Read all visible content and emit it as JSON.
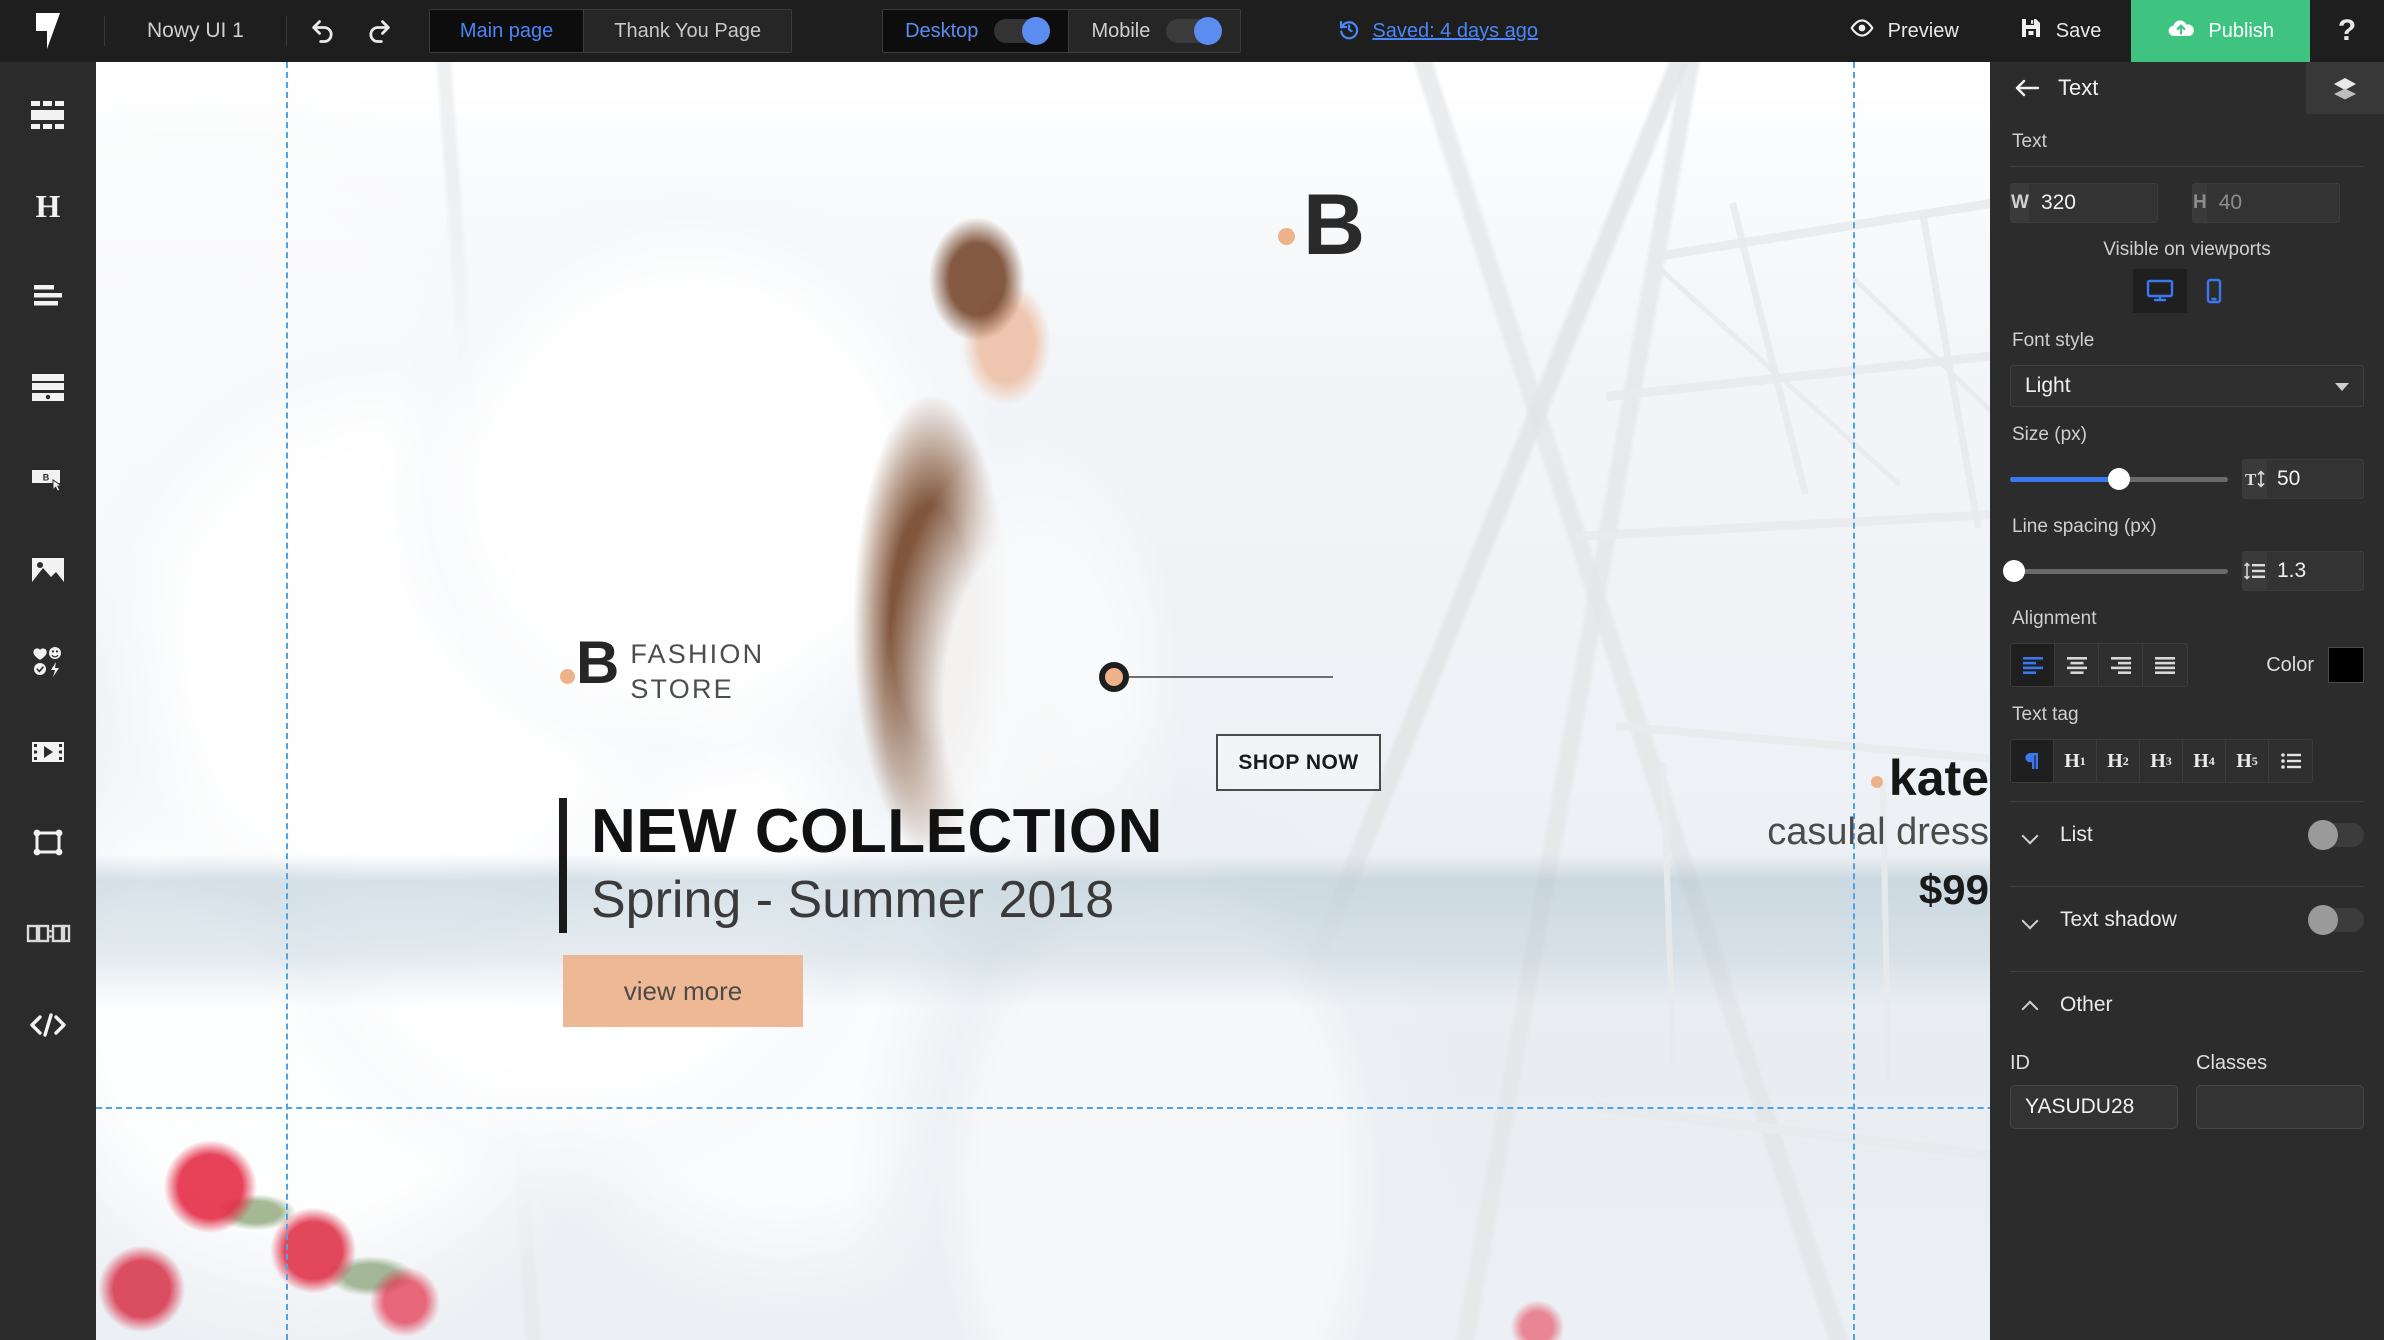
{
  "topbar": {
    "logo_icon": "brand-logo-icon",
    "project_name": "Nowy UI 1",
    "undo_icon": "undo-icon",
    "redo_icon": "redo-icon",
    "pages": [
      {
        "label": "Main page",
        "active": true
      },
      {
        "label": "Thank You Page",
        "active": false
      }
    ],
    "viewports": [
      {
        "label": "Desktop",
        "on": true,
        "active": true
      },
      {
        "label": "Mobile",
        "on": true,
        "active": false
      }
    ],
    "history_icon": "history-revert-icon",
    "saved_text": "Saved: 4 days ago",
    "actions": [
      {
        "label": "Preview",
        "icon": "eye-icon"
      },
      {
        "label": "Save",
        "icon": "floppy-disk-icon"
      },
      {
        "label": "Publish",
        "icon": "cloud-upload-icon"
      }
    ],
    "help_label": "?",
    "accent_green": "#3fc380",
    "accent_blue": "#4a86f7"
  },
  "sidebar": {
    "items": [
      {
        "name": "blocks-layout-icon"
      },
      {
        "name": "heading-icon"
      },
      {
        "name": "text-paragraph-icon"
      },
      {
        "name": "form-icon"
      },
      {
        "name": "button-icon"
      },
      {
        "name": "image-icon"
      },
      {
        "name": "icons-icon"
      },
      {
        "name": "video-icon"
      },
      {
        "name": "shape-frame-icon"
      },
      {
        "name": "countdown-timer-icon"
      },
      {
        "name": "html-code-icon"
      }
    ]
  },
  "canvas": {
    "collapse_button_icon": "minus-icon",
    "hero_letter": "B",
    "brand": {
      "initial": "B",
      "line1": "FASHION",
      "line2": "STORE"
    },
    "headline": "NEW COLLECTION",
    "subheadline": "Spring - Summer 2018",
    "cta_label": "view more",
    "product": {
      "name": "kate",
      "description": "casulal dress",
      "price": "$99",
      "shop_label": "SHOP NOW"
    },
    "accent_peach": "#efb894"
  },
  "panel": {
    "back_icon": "arrow-left-icon",
    "title": "Text",
    "layers_icon": "layers-icon",
    "section_label": "Text",
    "size": {
      "w_label": "W",
      "w_value": "320",
      "h_label": "H",
      "h_value": "40"
    },
    "viewports_label": "Visible on viewports",
    "viewport_buttons": [
      {
        "name": "desktop-icon",
        "active": true
      },
      {
        "name": "mobile-icon",
        "active": false
      }
    ],
    "font_style": {
      "label": "Font style",
      "value": "Light"
    },
    "font_size": {
      "label": "Size (px)",
      "value": "50",
      "icon": "font-size-icon",
      "slider_percent": 50
    },
    "line_spacing": {
      "label": "Line spacing (px)",
      "value": "1.3",
      "icon": "line-spacing-icon",
      "slider_percent": 2
    },
    "alignment": {
      "label": "Alignment",
      "options": [
        {
          "name": "align-left-icon",
          "active": true
        },
        {
          "name": "align-center-icon",
          "active": false
        },
        {
          "name": "align-right-icon",
          "active": false
        },
        {
          "name": "align-justify-icon",
          "active": false
        }
      ]
    },
    "color": {
      "label": "Color",
      "value": "#000000"
    },
    "text_tag": {
      "label": "Text tag",
      "options": [
        {
          "label": "",
          "name": "paragraph-icon",
          "active": true
        },
        {
          "label": "H",
          "sup": "1",
          "name": "h1-tag",
          "active": false
        },
        {
          "label": "H",
          "sup": "2",
          "name": "h2-tag",
          "active": false
        },
        {
          "label": "H",
          "sup": "3",
          "name": "h3-tag",
          "active": false
        },
        {
          "label": "H",
          "sup": "4",
          "name": "h4-tag",
          "active": false
        },
        {
          "label": "H",
          "sup": "5",
          "name": "h5-tag",
          "active": false
        },
        {
          "label": "",
          "name": "list-tag-icon",
          "active": false
        }
      ]
    },
    "accordions": [
      {
        "label": "List",
        "expanded": false,
        "toggle_on": false
      },
      {
        "label": "Text shadow",
        "expanded": false,
        "toggle_on": false
      },
      {
        "label": "Other",
        "expanded": true
      }
    ],
    "other": {
      "id_label": "ID",
      "id_value": "YASUDU28",
      "classes_label": "Classes",
      "classes_value": ""
    }
  }
}
